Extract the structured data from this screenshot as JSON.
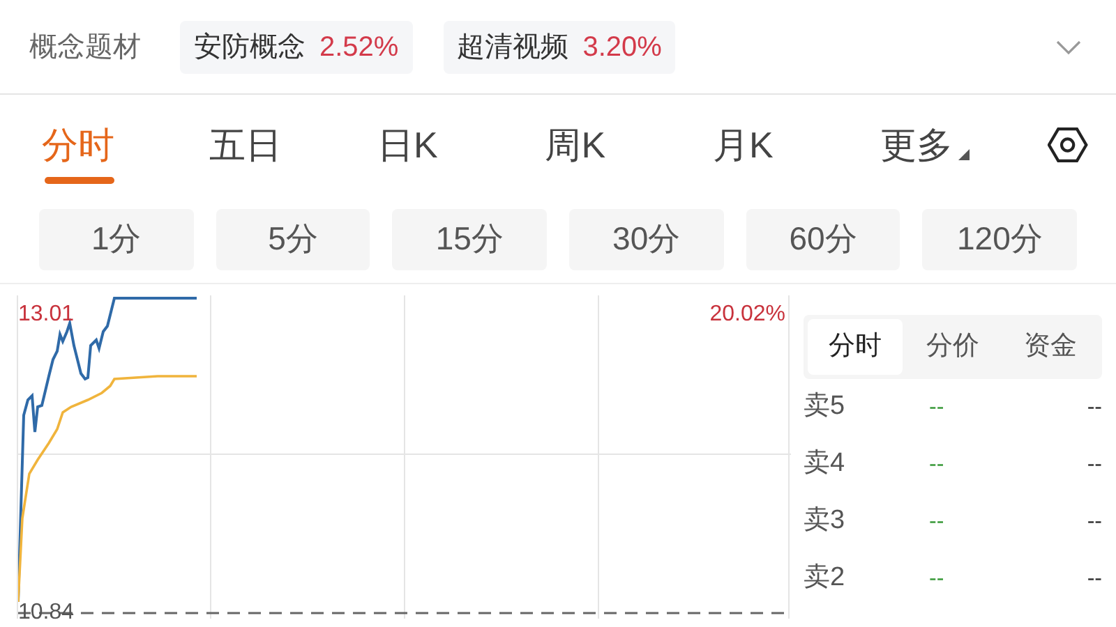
{
  "concepts": {
    "label": "概念题材",
    "tags": [
      {
        "name": "安防概念",
        "change": "2.52%"
      },
      {
        "name": "超清视频",
        "change": "3.20%"
      }
    ]
  },
  "period_tabs": [
    {
      "label": "分时",
      "selected": true
    },
    {
      "label": "五日",
      "selected": false
    },
    {
      "label": "日K",
      "selected": false
    },
    {
      "label": "周K",
      "selected": false
    },
    {
      "label": "月K",
      "selected": false
    },
    {
      "label": "更多",
      "selected": false,
      "kind": "menu"
    }
  ],
  "interval_buttons": [
    "1分",
    "5分",
    "15分",
    "30分",
    "60分",
    "120分"
  ],
  "chart": {
    "high_price": "13.01",
    "high_change": "20.02%",
    "base_price": "10.84"
  },
  "side_tabs": [
    {
      "label": "分时",
      "selected": true
    },
    {
      "label": "分价",
      "selected": false
    },
    {
      "label": "资金",
      "selected": false
    }
  ],
  "order_book": [
    {
      "label": "卖5",
      "price": "--",
      "volume": "--"
    },
    {
      "label": "卖4",
      "price": "--",
      "volume": "--"
    },
    {
      "label": "卖3",
      "price": "--",
      "volume": "--"
    },
    {
      "label": "卖2",
      "price": "--",
      "volume": "--"
    }
  ]
}
